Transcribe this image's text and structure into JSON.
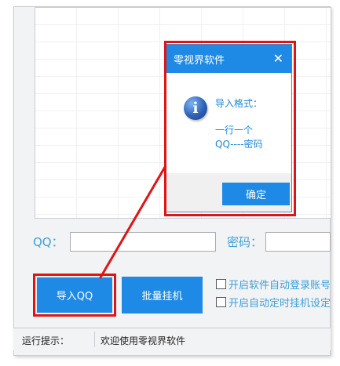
{
  "form": {
    "qq_label": "QQ：",
    "qq_value": "",
    "password_label": "密码：",
    "password_value": ""
  },
  "buttons": {
    "import_qq": "导入QQ",
    "batch_hang": "批量挂机"
  },
  "options": {
    "auto_login_label": "开启软件自动登录账号",
    "auto_timer_label": "开启自动定时挂机设定"
  },
  "status": {
    "label": "运行提示：",
    "message": "欢迎使用零视界软件"
  },
  "dialog": {
    "title": "零视界软件",
    "close_glyph": "✕",
    "info_glyph": "i",
    "line1": "导入格式：",
    "line2": "一行一个",
    "line3": "QQ----密码",
    "ok_label": "确定"
  },
  "colors": {
    "accent_blue": "#1e8ae6",
    "label_blue": "#3e9fd9",
    "highlight_red": "#e01414"
  }
}
